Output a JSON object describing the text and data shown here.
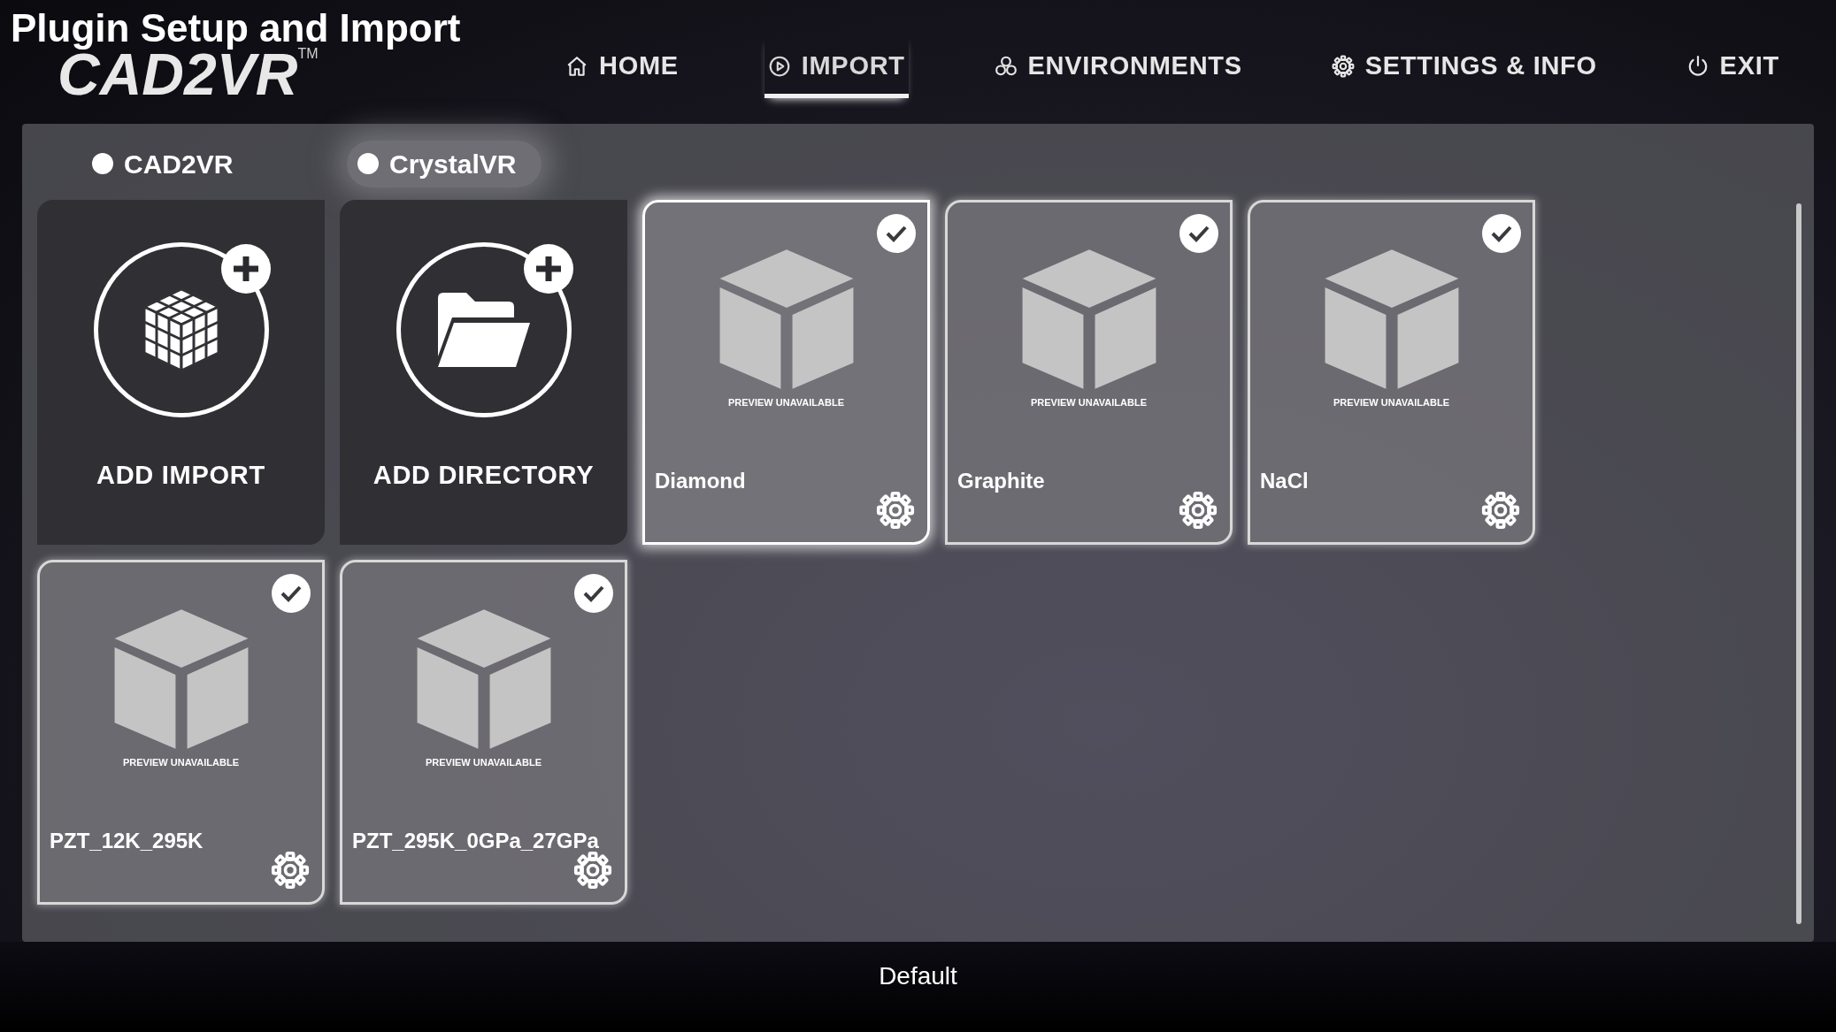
{
  "caption": "Plugin Setup and Import",
  "logo": {
    "text": "CAD2VR",
    "mark": "TM"
  },
  "nav": [
    {
      "label": "HOME",
      "selected": false
    },
    {
      "label": "IMPORT",
      "selected": true
    },
    {
      "label": "ENVIRONMENTS",
      "selected": false
    },
    {
      "label": "SETTINGS & INFO",
      "selected": false
    },
    {
      "label": "EXIT",
      "selected": false
    }
  ],
  "sources": [
    {
      "label": "CAD2VR",
      "selected": false
    },
    {
      "label": "CrystalVR",
      "selected": true
    }
  ],
  "cards": [
    {
      "kind": "import",
      "label": "ADD IMPORT"
    },
    {
      "kind": "directory",
      "label": "ADD DIRECTORY"
    },
    {
      "kind": "model",
      "name": "Diamond",
      "preview": "PREVIEW UNAVAILABLE",
      "checked": true,
      "highlighted": true
    },
    {
      "kind": "model",
      "name": "Graphite",
      "preview": "PREVIEW UNAVAILABLE",
      "checked": true,
      "highlighted": false
    },
    {
      "kind": "model",
      "name": "NaCl",
      "preview": "PREVIEW UNAVAILABLE",
      "checked": true,
      "highlighted": false
    },
    {
      "kind": "model",
      "name": "PZT_12K_295K",
      "preview": "PREVIEW UNAVAILABLE",
      "checked": true,
      "highlighted": false
    },
    {
      "kind": "model",
      "name": "PZT_295K_0GPa_27GPa",
      "preview": "PREVIEW UNAVAILABLE",
      "checked": true,
      "highlighted": false
    }
  ],
  "footer": "Default"
}
